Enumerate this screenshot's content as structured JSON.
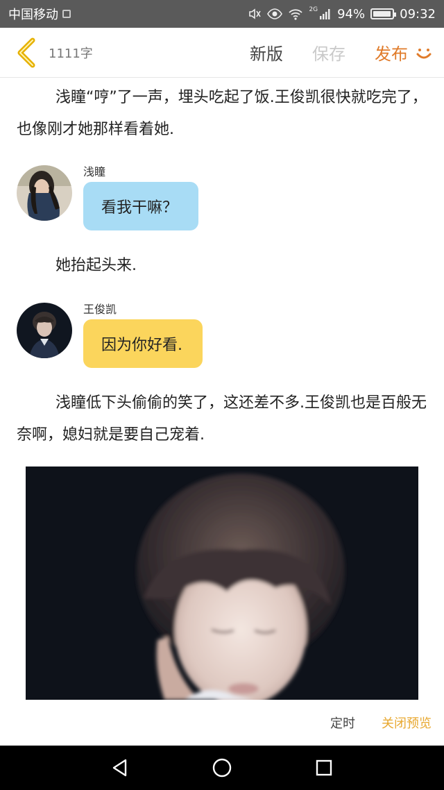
{
  "status_bar": {
    "carrier": "中国移动",
    "signal_label": "2G",
    "battery_percent": "94%",
    "battery_level": 0.94,
    "time": "09:32"
  },
  "top_bar": {
    "word_count": "1111字",
    "new_version": "新版",
    "save": "保存",
    "publish": "发布"
  },
  "colors": {
    "publish": "#e07b2a",
    "bubble_blue": "#a8dcf5",
    "bubble_yellow": "#fbd55c",
    "close_preview": "#e8a830"
  },
  "story": {
    "paragraph_1": "浅瞳“哼”了一声，埋头吃起了饭.王俊凯很快就吃完了，也像刚才她那样看着她.",
    "message_1": {
      "name": "浅瞳",
      "text": "看我干嘛？"
    },
    "paragraph_2": "她抬起头来.",
    "message_2": {
      "name": "王俊凯",
      "text": "因为你好看."
    },
    "paragraph_3": "浅瞳低下头偷偷的笑了，这还差不多.王俊凯也是百般无奈啊，媳妇就是要自己宠着."
  },
  "bottom_actions": {
    "timer": "定时",
    "close_preview": "关闭预览"
  },
  "nav_bar": {
    "icons": [
      "back-triangle-icon",
      "home-circle-icon",
      "recents-square-icon"
    ]
  }
}
